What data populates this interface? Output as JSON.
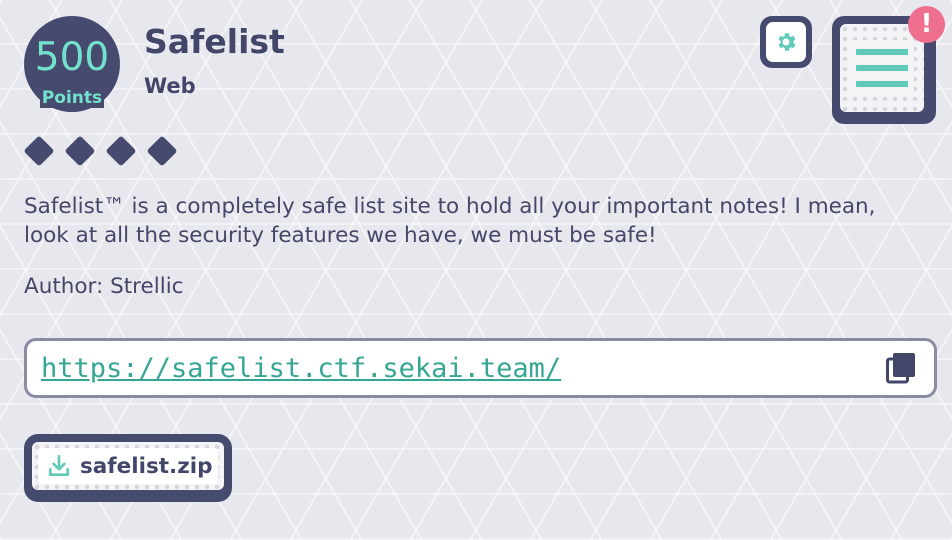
{
  "challenge": {
    "points_value": "500",
    "points_label": "Points",
    "title": "Safelist",
    "category": "Web",
    "difficulty_count": 4,
    "description": "Safelist™ is a completely safe list site to hold all your important notes! I mean, look at all the security features we have, we must be safe!",
    "author": "Author: Strellic",
    "url": "https://safelist.ctf.sekai.team/",
    "file_name": "safelist.zip"
  },
  "header": {
    "settings_icon": "gear-icon",
    "menu_icon": "hamburger-menu-icon",
    "alert_text": "!"
  },
  "colors": {
    "navy": "#464a6f",
    "teal": "#73e2cc",
    "link": "#35a694",
    "alert": "#ef6f8e"
  }
}
